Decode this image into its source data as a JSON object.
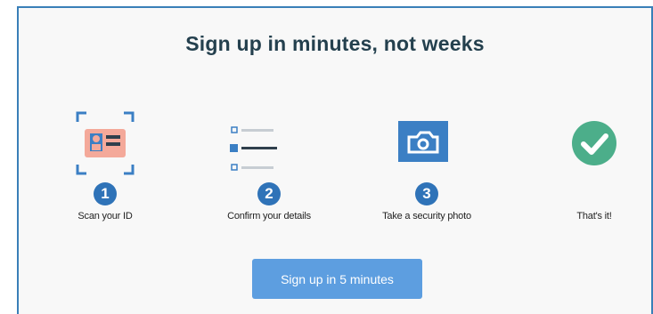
{
  "title": "Sign up in minutes, not weeks",
  "steps": [
    {
      "number": "1",
      "label": "Scan your ID",
      "icon": "id-scan-icon"
    },
    {
      "number": "2",
      "label": "Confirm your details",
      "icon": "checklist-icon"
    },
    {
      "number": "3",
      "label": "Take a security photo",
      "icon": "camera-icon"
    },
    {
      "number": "",
      "label": "That's it!",
      "icon": "checkmark-icon"
    }
  ],
  "cta_label": "Sign up in 5 minutes",
  "colors": {
    "accent_blue": "#2f73b8",
    "button_blue": "#5d9ee0",
    "success_green": "#4cae8a",
    "id_card": "#f4a99a",
    "title": "#24404e"
  }
}
